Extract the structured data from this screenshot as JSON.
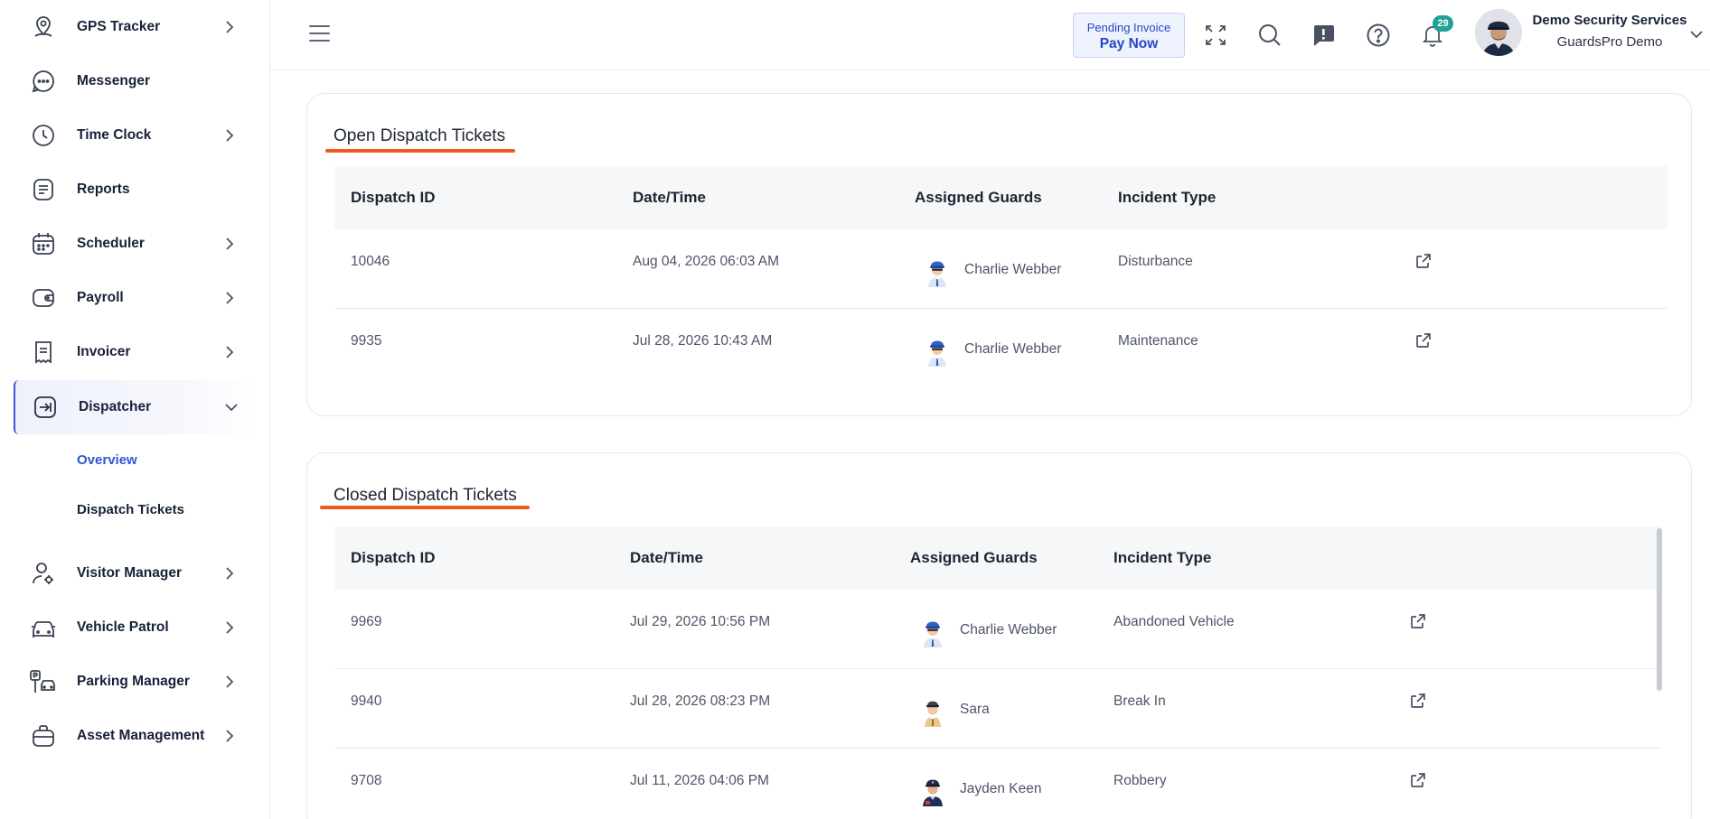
{
  "sidebar": {
    "items": [
      {
        "label": "GPS Tracker",
        "icon": "location-pin-icon",
        "chevron": "right"
      },
      {
        "label": "Messenger",
        "icon": "chat-bubble-icon",
        "chevron": "none"
      },
      {
        "label": "Time Clock",
        "icon": "clock-icon",
        "chevron": "right"
      },
      {
        "label": "Reports",
        "icon": "document-list-icon",
        "chevron": "none"
      },
      {
        "label": "Scheduler",
        "icon": "calendar-icon",
        "chevron": "right"
      },
      {
        "label": "Payroll",
        "icon": "wallet-icon",
        "chevron": "right"
      },
      {
        "label": "Invoicer",
        "icon": "receipt-icon",
        "chevron": "right"
      },
      {
        "label": "Dispatcher",
        "icon": "dispatch-arrow-icon",
        "chevron": "down"
      },
      {
        "label": "Visitor Manager",
        "icon": "user-gear-icon",
        "chevron": "right"
      },
      {
        "label": "Vehicle Patrol",
        "icon": "car-icon",
        "chevron": "right"
      },
      {
        "label": "Parking Manager",
        "icon": "parking-icon",
        "chevron": "right"
      },
      {
        "label": "Asset Management",
        "icon": "briefcase-icon",
        "chevron": "right"
      }
    ],
    "sub_items": [
      {
        "label": "Overview",
        "current": true
      },
      {
        "label": "Dispatch Tickets",
        "current": false
      }
    ]
  },
  "header": {
    "invoice_label": "Pending Invoice",
    "pay_label": "Pay Now",
    "notification_count": "29",
    "user_name": "Demo Security Services",
    "user_sub": "GuardsPro Demo"
  },
  "colors": {
    "accent": "#2f55d4",
    "underline": "#f15a1d",
    "badge": "#1fa197"
  },
  "open_tickets": {
    "title": "Open Dispatch Tickets",
    "columns": [
      "Dispatch ID",
      "Date/Time",
      "Assigned Guards",
      "Incident Type"
    ],
    "rows": [
      {
        "id": "10046",
        "datetime": "Aug 04, 2026 06:03 AM",
        "guard": "Charlie Webber",
        "incident": "Disturbance"
      },
      {
        "id": "9935",
        "datetime": "Jul 28, 2026 10:43 AM",
        "guard": "Charlie Webber",
        "incident": "Maintenance"
      }
    ]
  },
  "closed_tickets": {
    "title": "Closed Dispatch Tickets",
    "columns": [
      "Dispatch ID",
      "Date/Time",
      "Assigned Guards",
      "Incident Type"
    ],
    "rows": [
      {
        "id": "9969",
        "datetime": "Jul 29, 2026 10:56 PM",
        "guard": "Charlie Webber",
        "incident": "Abandoned Vehicle"
      },
      {
        "id": "9940",
        "datetime": "Jul 28, 2026 08:23 PM",
        "guard": "Sara",
        "incident": "Break In"
      },
      {
        "id": "9708",
        "datetime": "Jul 11, 2026 04:06 PM",
        "guard": "Jayden Keen",
        "incident": "Robbery"
      }
    ]
  }
}
